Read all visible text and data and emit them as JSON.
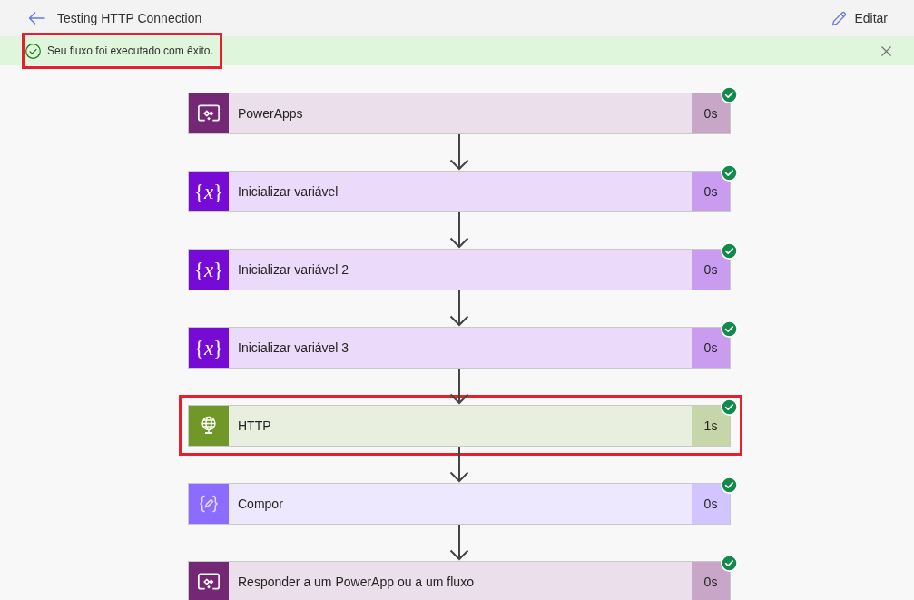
{
  "header": {
    "title": "Testing HTTP Connection",
    "edit_button": "Editar"
  },
  "banner": {
    "message": "Seu fluxo foi executado com êxito.",
    "highlighted": true
  },
  "steps": [
    {
      "kind": "powerapps",
      "title": "PowerApps",
      "duration": "0s",
      "succeeded": true,
      "highlighted": false
    },
    {
      "kind": "variable",
      "icon_glyph": "{*x*}",
      "title": "Inicializar variável",
      "duration": "0s",
      "succeeded": true,
      "highlighted": false
    },
    {
      "kind": "variable",
      "icon_glyph": "{*x*}",
      "title": "Inicializar variável 2",
      "duration": "0s",
      "succeeded": true,
      "highlighted": false
    },
    {
      "kind": "variable",
      "icon_glyph": "{*x*}",
      "title": "Inicializar variável 3",
      "duration": "0s",
      "succeeded": true,
      "highlighted": false
    },
    {
      "kind": "http",
      "title": "HTTP",
      "duration": "1s",
      "succeeded": true,
      "highlighted": true
    },
    {
      "kind": "compose",
      "title": "Compor",
      "duration": "0s",
      "succeeded": true,
      "highlighted": false
    },
    {
      "kind": "powerapps",
      "title": "Responder a um PowerApp ou a um fluxo",
      "duration": "0s",
      "succeeded": true,
      "highlighted": false
    }
  ]
}
